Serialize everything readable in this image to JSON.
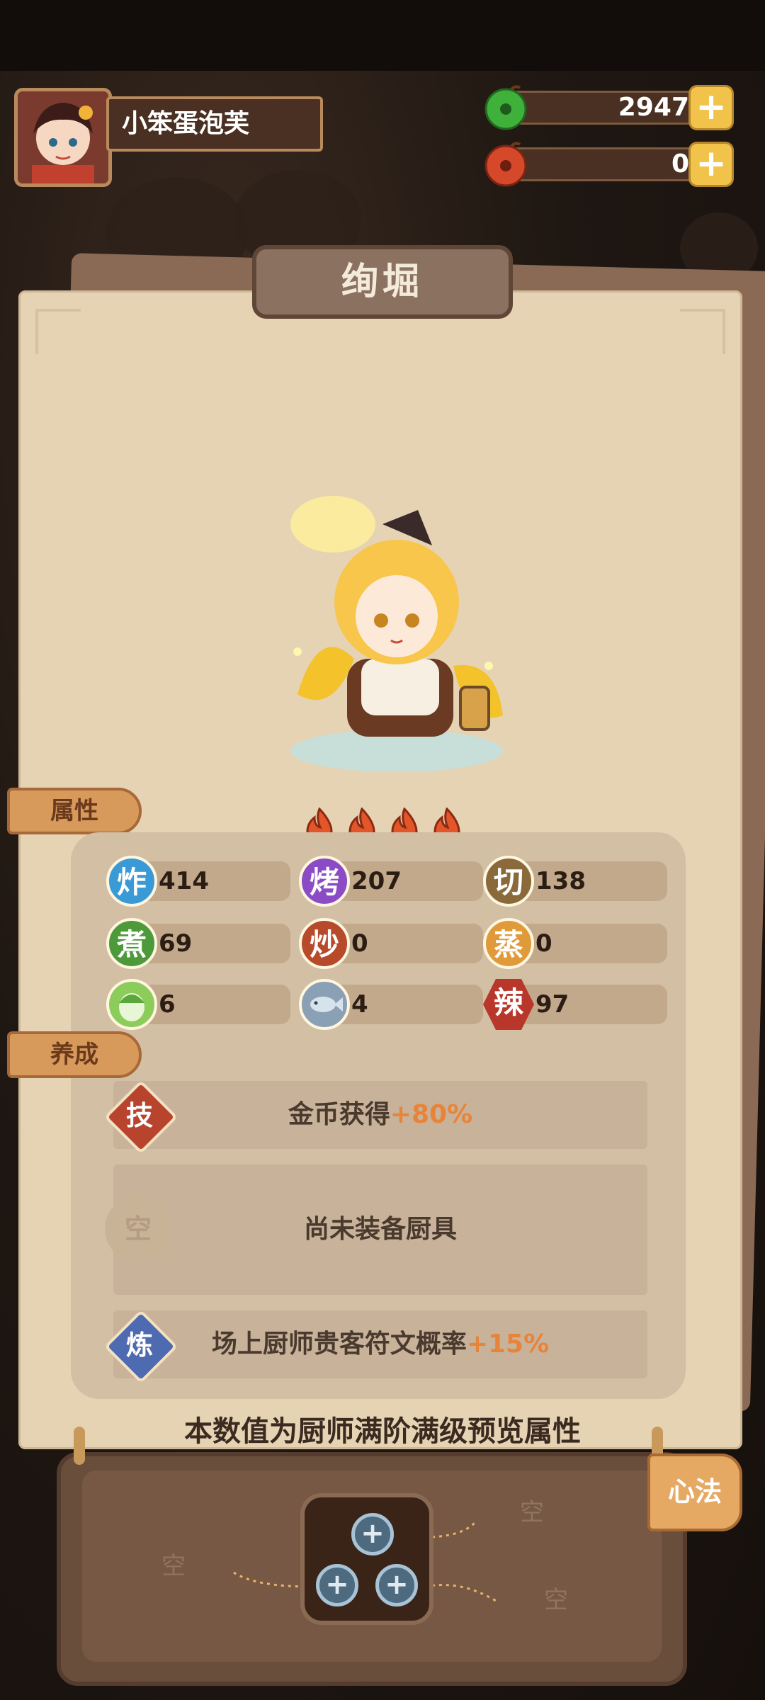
{
  "player": {
    "name": "小笨蛋泡芙"
  },
  "currencies": [
    {
      "name": "jade-coin",
      "amount": "2947",
      "color": "#3fb03a"
    },
    {
      "name": "red-coin",
      "amount": "0",
      "color": "#d5482a"
    }
  ],
  "chef": {
    "title": "绚堀",
    "star_count": 4
  },
  "sections": {
    "attributes": "属性",
    "cultivation": "养成"
  },
  "stats": [
    {
      "icon_char": "炸",
      "value": "414",
      "color": "#3a9ad6"
    },
    {
      "icon_char": "烤",
      "value": "207",
      "color": "#8a4bc4"
    },
    {
      "icon_char": "切",
      "value": "138",
      "color": "#8a6a3a"
    },
    {
      "icon_char": "煮",
      "value": "69",
      "color": "#4c9a3a"
    },
    {
      "icon_char": "炒",
      "value": "0",
      "color": "#b64a2a"
    },
    {
      "icon_char": "蒸",
      "value": "0",
      "color": "#e09a3a"
    },
    {
      "icon_char": "",
      "value": "6",
      "color": "#8ccc5a",
      "icon": "cabbage-icon"
    },
    {
      "icon_char": "",
      "value": "4",
      "color": "#8aa0b4",
      "icon": "fish-icon"
    },
    {
      "icon_char": "辣",
      "value": "97",
      "color": "#b8362a"
    }
  ],
  "traits": {
    "skill": {
      "badge": "技",
      "text": "金币获得",
      "bonus": "+80%"
    },
    "equip": {
      "badge": "空",
      "text": "尚未装备厨具"
    },
    "refine": {
      "badge": "炼",
      "text": "场上厨师贵客符文概率",
      "bonus": "+15%"
    }
  },
  "preview_note": "本数值为厨师满阶满级预览属性",
  "xinfa": {
    "tab_label": "心法",
    "empty_label": "空",
    "plus_label": "+"
  }
}
